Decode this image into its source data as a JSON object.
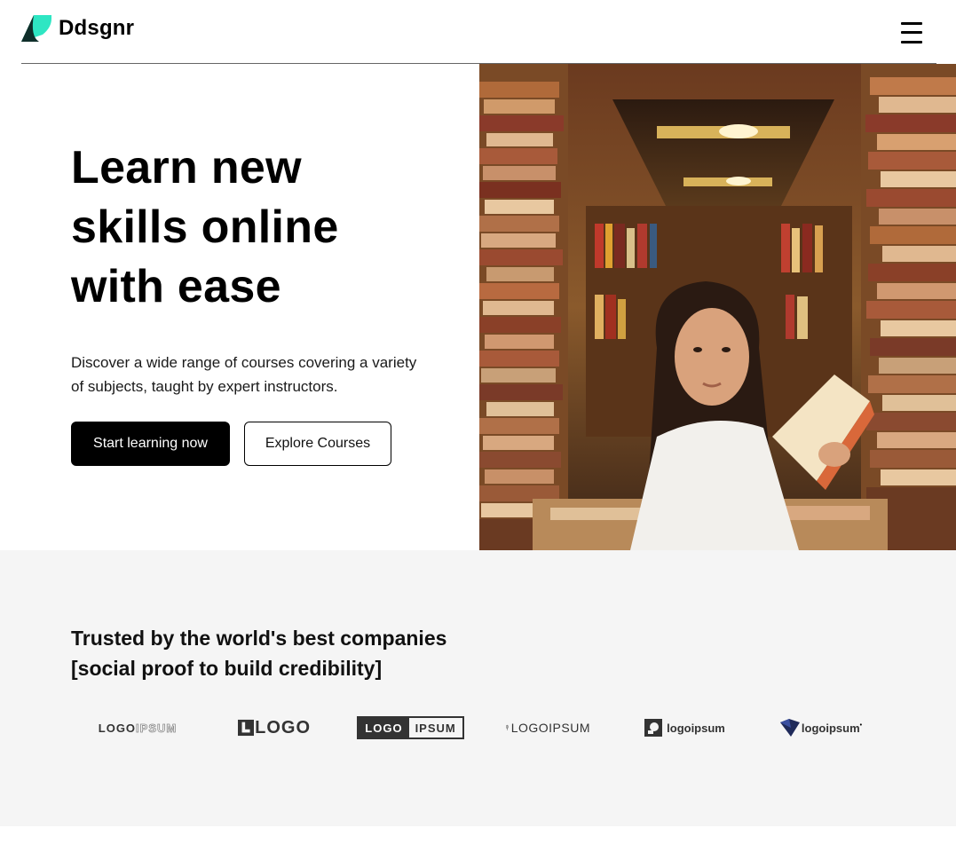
{
  "header": {
    "brand": "Ddsgnr",
    "brand_colors": {
      "mark_dark": "#0f2e2a",
      "mark_accent": "#2ee6c3"
    },
    "menu_icon": "hamburger-menu-icon"
  },
  "hero": {
    "title_line1": "Learn new",
    "title_line2": "skills online",
    "title_line3": "with ease",
    "subtitle": "Discover a wide range of courses covering a variety of subjects, taught by expert instructors.",
    "primary_button": "Start learning now",
    "secondary_button": "Explore Courses",
    "image_subject": "woman-reading-in-bookstore-photo"
  },
  "trusted": {
    "title_line1": "Trusted by the world's best companies",
    "title_line2": "[social proof to build credibility]",
    "logos": [
      {
        "name": "logo-1",
        "text_a": "LOGO",
        "text_b": "IPSUM"
      },
      {
        "name": "logo-2",
        "text": "LOGO"
      },
      {
        "name": "logo-3",
        "text_a": "LOGO",
        "text_b": "IPSUM"
      },
      {
        "name": "logo-4",
        "text": "LOGOIPSUM"
      },
      {
        "name": "logo-5",
        "text": "logoipsum"
      },
      {
        "name": "logo-6",
        "text": "logoipsum"
      }
    ]
  }
}
